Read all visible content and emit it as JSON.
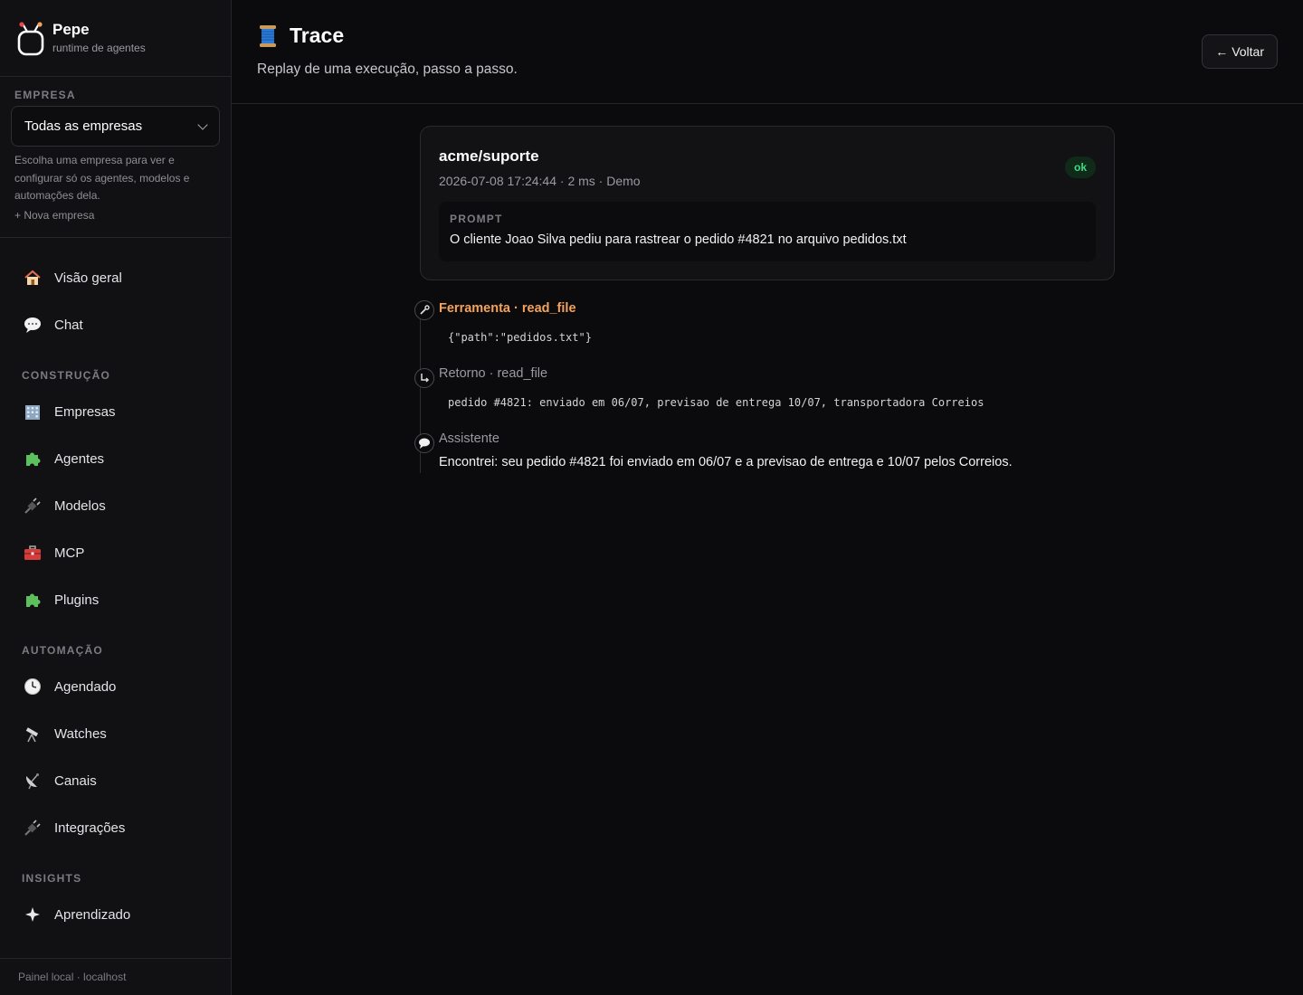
{
  "brand": {
    "name": "Pepe",
    "subtitle": "runtime de agentes"
  },
  "sidebar": {
    "company_section_label": "EMPRESA",
    "company_select_value": "Todas as empresas",
    "company_help": "Escolha uma empresa para ver e configurar só os agentes, modelos e automações dela.",
    "new_company_label": "+ Nova empresa",
    "nav_top": [
      {
        "label": "Visão geral",
        "icon": "house-icon"
      },
      {
        "label": "Chat",
        "icon": "speech-bubble-icon"
      }
    ],
    "section_construcao": "CONSTRUÇÃO",
    "nav_construcao": [
      {
        "label": "Empresas",
        "icon": "office-building-icon"
      },
      {
        "label": "Agentes",
        "icon": "puzzle-piece-icon"
      },
      {
        "label": "Modelos",
        "icon": "plug-icon"
      },
      {
        "label": "MCP",
        "icon": "toolbox-icon"
      },
      {
        "label": "Plugins",
        "icon": "puzzle-piece-icon"
      }
    ],
    "section_automacao": "AUTOMAÇÃO",
    "nav_automacao": [
      {
        "label": "Agendado",
        "icon": "clock-icon"
      },
      {
        "label": "Watches",
        "icon": "telescope-icon"
      },
      {
        "label": "Canais",
        "icon": "satellite-dish-icon"
      },
      {
        "label": "Integrações",
        "icon": "plug-icon"
      }
    ],
    "section_insights": "INSIGHTS",
    "nav_insights": [
      {
        "label": "Aprendizado",
        "icon": "sparkle-icon"
      }
    ],
    "footer": "Painel local · localhost"
  },
  "header": {
    "title": "Trace",
    "subtitle": "Replay de uma execução, passo a passo.",
    "back_label": "Voltar"
  },
  "run": {
    "name": "acme/suporte",
    "meta": "2026-07-08 17:24:44 · 2 ms  · Demo",
    "status": "ok",
    "prompt_label": "PROMPT",
    "prompt": "O cliente Joao Silva pediu para rastrear o pedido #4821 no arquivo pedidos.txt"
  },
  "steps": [
    {
      "title": "Ferramenta · read_file",
      "body": "{\"path\":\"pedidos.txt\"}",
      "icon": "wrench-icon"
    },
    {
      "title": "Retorno · read_file",
      "body": "pedido #4821: enviado em 06/07, previsao de entrega 10/07, transportadora Correios",
      "icon": "return-arrow-icon"
    },
    {
      "title": "Assistente",
      "body": "Encontrei: seu pedido #4821 foi enviado em 06/07 e a previsao de entrega e 10/07 pelos Correios.",
      "icon": "speech-bubble-icon"
    }
  ],
  "colors": {
    "accent_tool": "#f5a35b",
    "status_ok": "#3ddc84",
    "background": "#0b0b0d",
    "sidebar": "#111113"
  }
}
